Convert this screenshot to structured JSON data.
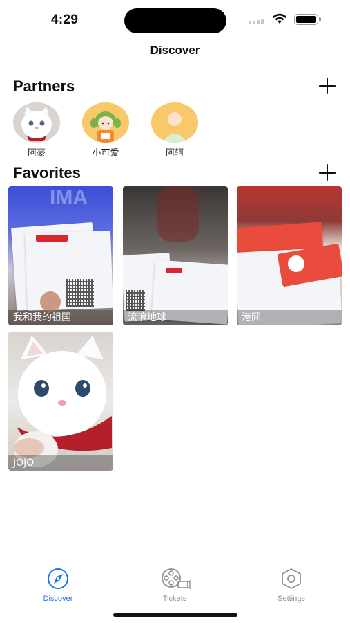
{
  "status_bar": {
    "time": "4:29"
  },
  "nav": {
    "title": "Discover"
  },
  "partners": {
    "title": "Partners",
    "items": [
      {
        "name": "阿豪",
        "avatar": "white-cat-photo"
      },
      {
        "name": "小可爱",
        "avatar": "girl-cartoon-avatar"
      },
      {
        "name": "阿轲",
        "avatar": "default-person-avatar"
      }
    ]
  },
  "favorites": {
    "title": "Favorites",
    "items": [
      {
        "caption": "我和我的祖国",
        "image": "movie-ticket-photo"
      },
      {
        "caption": "流浪地球",
        "image": "movie-ticket-photo"
      },
      {
        "caption": "港囧",
        "image": "movie-ticket-photo"
      },
      {
        "caption": "JOJO",
        "image": "white-cat-photo"
      }
    ]
  },
  "tabs": [
    {
      "label": "Discover",
      "icon": "compass-icon",
      "active": true
    },
    {
      "label": "Tickets",
      "icon": "film-reel-icon",
      "active": false
    },
    {
      "label": "Settings",
      "icon": "hexagon-gear-icon",
      "active": false
    }
  ],
  "colors": {
    "accent": "#1a73e8",
    "inactive": "#8e8e93",
    "avatar_yellow": "#f8c96b"
  }
}
